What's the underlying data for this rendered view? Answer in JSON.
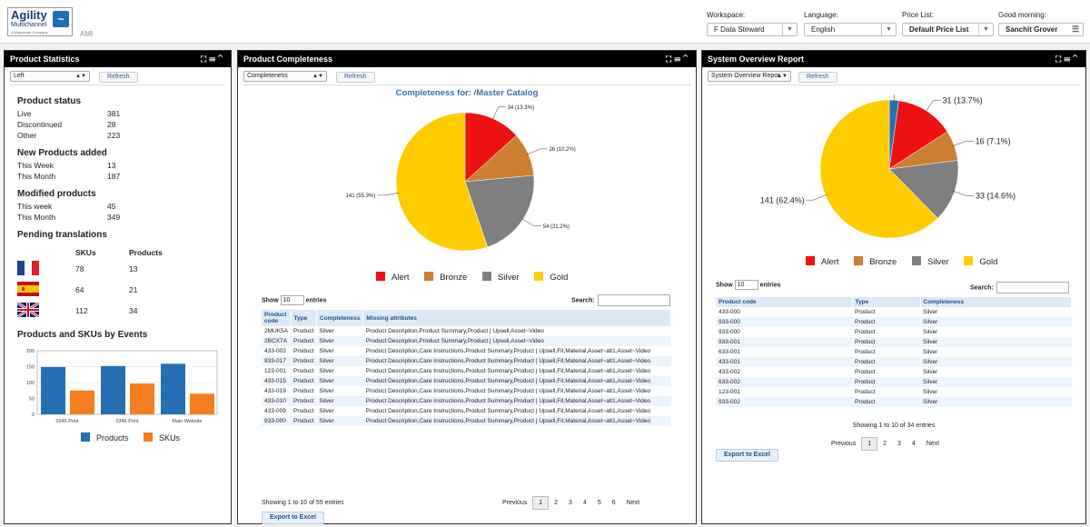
{
  "header": {
    "logo_title": "Agility",
    "logo_sub": "Multichannel",
    "logo_tagline": "A Magnitude Company",
    "ami": "AMI",
    "workspace": {
      "label": "Workspace:",
      "value": "F Data Steward"
    },
    "language": {
      "label": "Language:",
      "value": "English"
    },
    "price_list": {
      "label": "Price List:",
      "value": "Default Price List"
    },
    "greeting": {
      "label": "Good morning:",
      "value": "Sanchit Grover"
    }
  },
  "product_statistics": {
    "title": "Product Statistics",
    "select": "Left",
    "refresh": "Refresh",
    "status_heading": "Product status",
    "status": [
      {
        "label": "Live",
        "value": "381"
      },
      {
        "label": "Discontinued",
        "value": "28"
      },
      {
        "label": "Other",
        "value": "223"
      }
    ],
    "new_heading": "New Products added",
    "new": [
      {
        "label": "This Week",
        "value": "13"
      },
      {
        "label": "This Month",
        "value": "187"
      }
    ],
    "modified_heading": "Modified products",
    "modified": [
      {
        "label": "This week",
        "value": "45"
      },
      {
        "label": "This Month",
        "value": "349"
      }
    ],
    "pending_heading": "Pending translations",
    "col_skus": "SKUs",
    "col_products": "Products",
    "translations": [
      {
        "flag": "france-flag-icon",
        "skus": "78",
        "products": "13"
      },
      {
        "flag": "spain-flag-icon",
        "skus": "64",
        "products": "21"
      },
      {
        "flag": "uk-flag-icon",
        "skus": "112",
        "products": "34"
      }
    ],
    "events_heading": "Products and SKUs by Events"
  },
  "chart_data": [
    {
      "type": "bar",
      "title": "Products and SKUs by Events",
      "categories": [
        "0345 Print",
        "0346 Print",
        "Main Website"
      ],
      "series": [
        {
          "name": "Products",
          "values": [
            149,
            152,
            159
          ],
          "color": "#2470b3"
        },
        {
          "name": "SKUs",
          "values": [
            75,
            97,
            65
          ],
          "color": "#f57f20"
        }
      ],
      "ylim": [
        0,
        200
      ],
      "yticks": [
        "0",
        "50",
        "100",
        "150",
        "200"
      ],
      "legend": "bottom",
      "grid": true
    },
    {
      "type": "pie",
      "title": "Completeness for: /Master Catalog",
      "slices": [
        {
          "name": "Alert",
          "value": 34,
          "label": "34 (13.3%)",
          "color": "#ee1111"
        },
        {
          "name": "Bronze",
          "value": 26,
          "label": "26 (10.2%)",
          "color": "#cd7f32"
        },
        {
          "name": "Silver",
          "value": 54,
          "label": "54 (21.2%)",
          "color": "#7f7f7f"
        },
        {
          "name": "Gold",
          "value": 141,
          "label": "141 (55.3%)",
          "color": "#ffcc00"
        }
      ],
      "legend": "bottom"
    },
    {
      "type": "pie",
      "title": "",
      "slices": [
        {
          "name": "",
          "value": 5,
          "label": "5 (2.2%)",
          "color": "#2470b3"
        },
        {
          "name": "Alert",
          "value": 31,
          "label": "31 (13.7%)",
          "color": "#ee1111"
        },
        {
          "name": "Bronze",
          "value": 16,
          "label": "16 (7.1%)",
          "color": "#cd7f32"
        },
        {
          "name": "Silver",
          "value": 33,
          "label": "33 (14.6%)",
          "color": "#7f7f7f"
        },
        {
          "name": "Gold",
          "value": 141,
          "label": "141 (62.4%)",
          "color": "#ffcc00"
        }
      ],
      "legend": "bottom"
    }
  ],
  "product_completeness": {
    "title": "Product Completeness",
    "select": "Completeness",
    "refresh": "Refresh",
    "show_label": "Show",
    "show_value": "10",
    "entries_label": "entries",
    "search_label": "Search:",
    "columns": [
      "Product code",
      "Type",
      "Completeness",
      "Missing attributes"
    ],
    "rows": [
      [
        "2MUK5A",
        "Product",
        "Silver",
        "Product Description,Product Summary,Product | Upsell,Asset~Video"
      ],
      [
        "2BCX7A",
        "Product",
        "Silver",
        "Product Description,Product Summary,Product | Upsell,Asset~Video"
      ],
      [
        "433-003",
        "Product",
        "Silver",
        "Product Description,Care Instructions,Product Summary,Product | Upsell,Fit,Material,Asset~alt1,Asset~Video"
      ],
      [
        "933-017",
        "Product",
        "Silver",
        "Product Description,Care Instructions,Product Summary,Product | Upsell,Fit,Material,Asset~alt1,Asset~Video"
      ],
      [
        "123-001",
        "Product",
        "Silver",
        "Product Description,Care Instructions,Product Summary,Product | Upsell,Fit,Material,Asset~alt1,Asset~Video"
      ],
      [
        "433-015",
        "Product",
        "Silver",
        "Product Description,Care Instructions,Product Summary,Product | Upsell,Fit,Material,Asset~alt1,Asset~Video"
      ],
      [
        "433-019",
        "Product",
        "Silver",
        "Product Description,Care Instructions,Product Summary,Product | Upsell,Fit,Material,Asset~alt1,Asset~Video"
      ],
      [
        "433-010",
        "Product",
        "Silver",
        "Product Description,Care Instructions,Product Summary,Product | Upsell,Fit,Material,Asset~alt1,Asset~Video"
      ],
      [
        "433-009",
        "Product",
        "Silver",
        "Product Description,Care Instructions,Product Summary,Product | Upsell,Fit,Material,Asset~alt1,Asset~Video"
      ],
      [
        "933-000",
        "Product",
        "Silver",
        "Product Description,Care Instructions,Product Summary,Product | Upsell,Fit,Material,Asset~alt1,Asset~Video"
      ]
    ],
    "info": "Showing 1 to 10 of 55 entries",
    "pager": [
      "Previous",
      "1",
      "2",
      "3",
      "4",
      "5",
      "6",
      "Next"
    ],
    "export": "Export to Excel"
  },
  "system_overview": {
    "title": "System Overview Report",
    "select": "System Overview Repor",
    "refresh": "Refresh",
    "show_label": "Show",
    "show_value": "10",
    "entries_label": "entries",
    "search_label": "Search:",
    "columns": [
      "Product code",
      "Type",
      "Completeness"
    ],
    "rows": [
      [
        "433-000",
        "Product",
        "Silver"
      ],
      [
        "933-000",
        "Product",
        "Silver"
      ],
      [
        "933-000",
        "Product",
        "Silver"
      ],
      [
        "933-001",
        "Product",
        "Silver"
      ],
      [
        "633-001",
        "Product",
        "Silver"
      ],
      [
        "433-001",
        "Product",
        "Silver"
      ],
      [
        "433-002",
        "Product",
        "Silver"
      ],
      [
        "633-002",
        "Product",
        "Silver"
      ],
      [
        "123-001",
        "Product",
        "Silver"
      ],
      [
        "933-002",
        "Product",
        "Silver"
      ]
    ],
    "info": "Showing 1 to 10 of 34 entries",
    "pager": [
      "Previous",
      "1",
      "2",
      "3",
      "4",
      "Next"
    ],
    "export": "Export to Excel"
  }
}
